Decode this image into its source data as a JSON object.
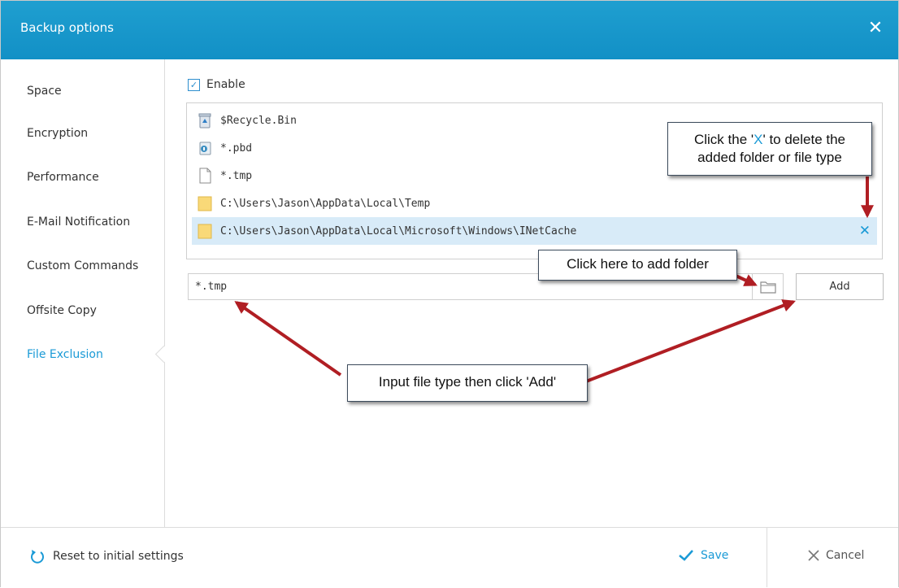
{
  "window": {
    "title": "Backup options",
    "close_glyph": "✕"
  },
  "sidebar": {
    "items": [
      {
        "label": "Space"
      },
      {
        "label": "Encryption"
      },
      {
        "label": "Performance"
      },
      {
        "label": "E-Mail Notification"
      },
      {
        "label": "Custom Commands"
      },
      {
        "label": "Offsite Copy"
      },
      {
        "label": "File Exclusion",
        "active": true
      }
    ]
  },
  "exclusion": {
    "enable_label": "Enable",
    "enable_checked": true,
    "list": [
      {
        "text": "$Recycle.Bin",
        "icon": "recycle-bin-icon"
      },
      {
        "text": "*.pbd",
        "icon": "backup-file-icon"
      },
      {
        "text": "*.tmp",
        "icon": "file-icon"
      },
      {
        "text": "C:\\Users\\Jason\\AppData\\Local\\Temp",
        "icon": "folder-icon"
      },
      {
        "text": "C:\\Users\\Jason\\AppData\\Local\\Microsoft\\Windows\\INetCache",
        "icon": "folder-icon",
        "selected": true,
        "delete_glyph": "✕"
      }
    ],
    "input_value": "*.tmp",
    "add_label": "Add",
    "browse_icon": "folder-outline-icon"
  },
  "annotations": {
    "delete_callout": {
      "pre": "Click the '",
      "x": "X",
      "post": "' to delete the",
      "line2": "added folder or file type"
    },
    "browse_callout": "Click here to add folder",
    "input_callout": "Input file type then click 'Add'"
  },
  "footer": {
    "reset_label": "Reset to initial settings",
    "save_label": "Save",
    "cancel_label": "Cancel"
  },
  "colors": {
    "accent": "#1a9ad6",
    "titlebar": "#1896cb",
    "selected_row": "#d8ebf8",
    "arrow": "#b01e23"
  }
}
